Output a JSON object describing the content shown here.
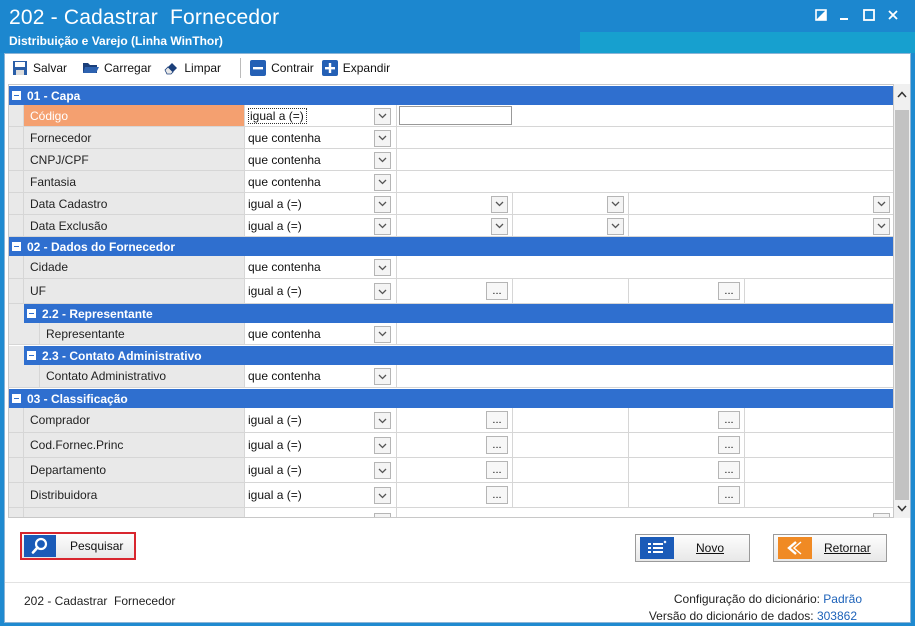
{
  "window": {
    "title": "202 - Cadastrar  Fornecedor",
    "subtitle": "Distribuição e Varejo (Linha WinThor)",
    "controls": [
      "restore-icon",
      "minimize-icon",
      "maximize-icon",
      "close-icon"
    ]
  },
  "toolbar": {
    "salvar": "Salvar",
    "carregar": "Carregar",
    "limpar": "Limpar",
    "contrair": "Contrair",
    "expandir": "Expandir"
  },
  "groups": {
    "capa": "01 - Capa",
    "dados": "02 - Dados do Fornecedor",
    "representante": "2.2 - Representante",
    "contato": "2.3 - Contato Administrativo",
    "classificacao": "03 - Classificação"
  },
  "rows": {
    "codigo": {
      "label": "Código",
      "op": "igual a (=)"
    },
    "fornecedor": {
      "label": "Fornecedor",
      "op": "que contenha"
    },
    "cnpj": {
      "label": "CNPJ/CPF",
      "op": "que contenha"
    },
    "fantasia": {
      "label": "Fantasia",
      "op": "que contenha"
    },
    "data_cadastro": {
      "label": "Data Cadastro",
      "op": "igual a (=)"
    },
    "data_exclusao": {
      "label": "Data Exclusão",
      "op": "igual a (=)"
    },
    "cidade": {
      "label": "Cidade",
      "op": "que contenha"
    },
    "uf": {
      "label": "UF",
      "op": "igual a (=)"
    },
    "representante": {
      "label": "Representante",
      "op": "que contenha"
    },
    "contato_adm": {
      "label": "Contato Administrativo",
      "op": "que contenha"
    },
    "comprador": {
      "label": "Comprador",
      "op": "igual a (=)"
    },
    "cod_fornec_princ": {
      "label": "Cod.Fornec.Princ",
      "op": "igual a (=)"
    },
    "departamento": {
      "label": "Departamento",
      "op": "igual a (=)"
    },
    "distribuidora": {
      "label": "Distribuidora",
      "op": "igual a (=)"
    }
  },
  "ellipsis": "...",
  "buttons": {
    "pesquisar": "Pesquisar",
    "novo": "Novo",
    "retornar": "Retornar"
  },
  "footer": {
    "title": "202 - Cadastrar  Fornecedor",
    "config_label": "Configuração do dicionário:",
    "config_value": "Padrão",
    "versao_label": "Versão do dicionário de dados:",
    "versao_value": "303862"
  },
  "colors": {
    "titlebar": "#1c87cf",
    "group_header": "#2f6fcf",
    "selected_label": "#f4a070",
    "pesquisar_border": "#d8262e",
    "link_value": "#1d62b9"
  }
}
